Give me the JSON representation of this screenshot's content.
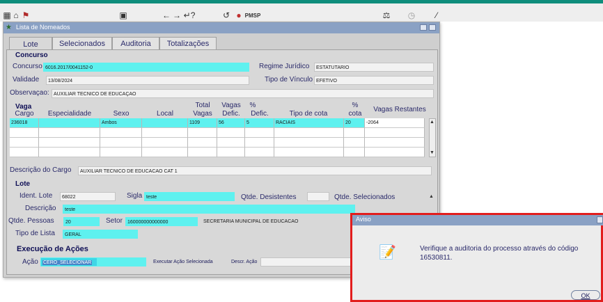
{
  "toolbar": {
    "app_label": "PMSP",
    "icons": [
      "save-icon",
      "home-icon",
      "key-icon",
      "calculator-icon",
      "arrow-left-icon",
      "arrow-right-icon",
      "help-icon",
      "refresh-icon",
      "circle-icon",
      "scales-icon",
      "clock-icon"
    ]
  },
  "window": {
    "title": "Lista de Nomeados",
    "tabs": [
      "Lote",
      "Selecionados",
      "Auditoria",
      "Totalizações"
    ],
    "active_tab": "Lote"
  },
  "concurso": {
    "section_title": "Concurso",
    "concurso_label": "Concurso",
    "concurso_value": "6016.2017/0041152-0",
    "regime_label": "Regime Jurídico",
    "regime_value": "ESTATUTARIO",
    "validade_label": "Validade",
    "validade_value": "13/08/2024",
    "tipo_vinculo_label": "Tipo de Vínculo",
    "tipo_vinculo_value": "EFETIVO",
    "observacao_label": "Observaçao:",
    "observacao_value": "AUXILIAR TECNICO DE EDUCAÇAO"
  },
  "vaga": {
    "section_title": "Vaga",
    "headers": {
      "cargo": "Cargo",
      "especialidade": "Especialidade",
      "sexo": "Sexo",
      "local": "Local",
      "total_top": "Total",
      "total_bottom": "Vagas",
      "vagas_top": "Vagas",
      "vagas_bottom": "Defic.",
      "pct_top": "%",
      "pct_bottom": "Defic.",
      "tipo_cota": "Tipo de cota",
      "cota_top": "%",
      "cota_bottom": "cota",
      "restantes": "Vagas Restantes"
    },
    "row": {
      "cargo": "236018",
      "especialidade": "",
      "sexo": "Ambos",
      "local": "",
      "total": "1109",
      "vagas_defic": "56",
      "pct_defic": "5",
      "tipo_cota": "RACIAIS",
      "pct_cota": "20",
      "restantes": "-2064"
    },
    "descricao_label": "Descrição do Cargo",
    "descricao_value": "AUXILIAR TECNICO DE EDUCACAO CAT 1"
  },
  "lote": {
    "section_title": "Lote",
    "ident_label": "Ident. Lote",
    "ident_value": "68022",
    "sigla_label": "Sigla",
    "sigla_value": "teste",
    "desistentes_label": "Qtde. Desistentes",
    "selecionados_label": "Qtde. Selecionados",
    "descricao_label": "Descrição",
    "descricao_value": "teste",
    "pessoas_label": "Qtde. Pessoas",
    "pessoas_value": "20",
    "setor_label": "Setor",
    "setor_value": "160000000000000",
    "setor_nome": "SECRETARIA MUNICIPAL DE EDUCACAO",
    "tipo_lista_label": "Tipo de Lista",
    "tipo_lista_value": "GERAL"
  },
  "execucao": {
    "section_title": "Execução de Ações",
    "acao_label": "Ação",
    "acao_value": "CERO_SELECIONAR",
    "executar_label": "Executar Ação Selecionada",
    "descr_acao_label": "Descr. Ação"
  },
  "dialog": {
    "title": "Aviso",
    "message_line1": "Verifique a auditoria do processo através do código",
    "message_line2": "16530811.",
    "ok_label": "OK"
  }
}
